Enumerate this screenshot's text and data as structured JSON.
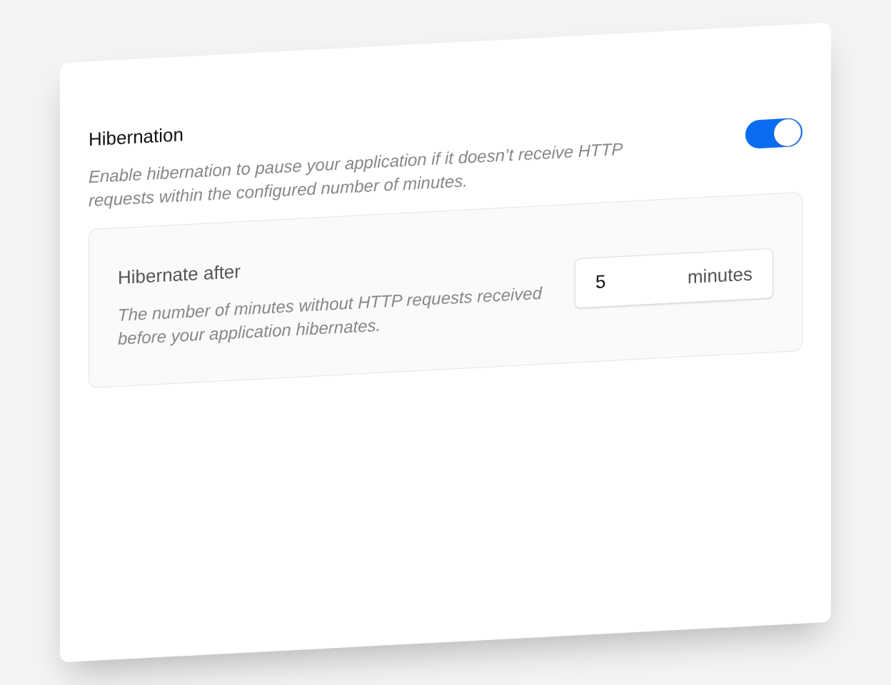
{
  "section": {
    "title": "Hibernation",
    "description": "Enable hibernation to pause your application if it doesn’t receive HTTP requests within the configured number of minutes.",
    "toggle": {
      "on": true
    }
  },
  "setting": {
    "title": "Hibernate after",
    "description": "The number of minutes without HTTP requests received before your application hibernates.",
    "value": "5",
    "unit": "minutes"
  }
}
